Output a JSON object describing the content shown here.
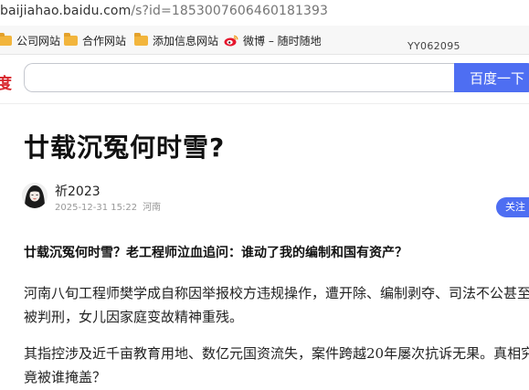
{
  "browser": {
    "url_host": "baijiahao.baidu.com",
    "url_path": "/s?id=1853007606460181393"
  },
  "bookmarks": [
    {
      "label": "公司网站",
      "icon": "folder-icon"
    },
    {
      "label": "合作网站",
      "icon": "folder-icon"
    },
    {
      "label": "添加信息网站",
      "icon": "folder-icon"
    },
    {
      "label": "微博 – 随时随地",
      "icon": "weibo-icon"
    }
  ],
  "watermark": "YY062095",
  "search": {
    "logo_text": "度",
    "input_value": "",
    "button_label": "百度一下"
  },
  "article": {
    "title": "廿载沉冤何时雪?",
    "author": "祈2023",
    "date": "2025-12-31 15:22",
    "location": "河南",
    "follow_label": "关注",
    "lead": "廿载沉冤何时雪？老工程师泣血追问：谁动了我的编制和国有资产？",
    "paragraph_1": "河南八旬工程师樊学成自称因举报校方违规操作，遭开除、编制剥夺、司法不公甚至被判刑，女儿因家庭变故精神重残。",
    "paragraph_2": "其指控涉及近千亩教育用地、数亿元国资流失，案件跨越20年屡次抗诉无果。真相究竟被谁掩盖？"
  },
  "colors": {
    "accent": "#4e6ef2",
    "logo_red": "#d8262c",
    "folder": "#f2b53c"
  }
}
